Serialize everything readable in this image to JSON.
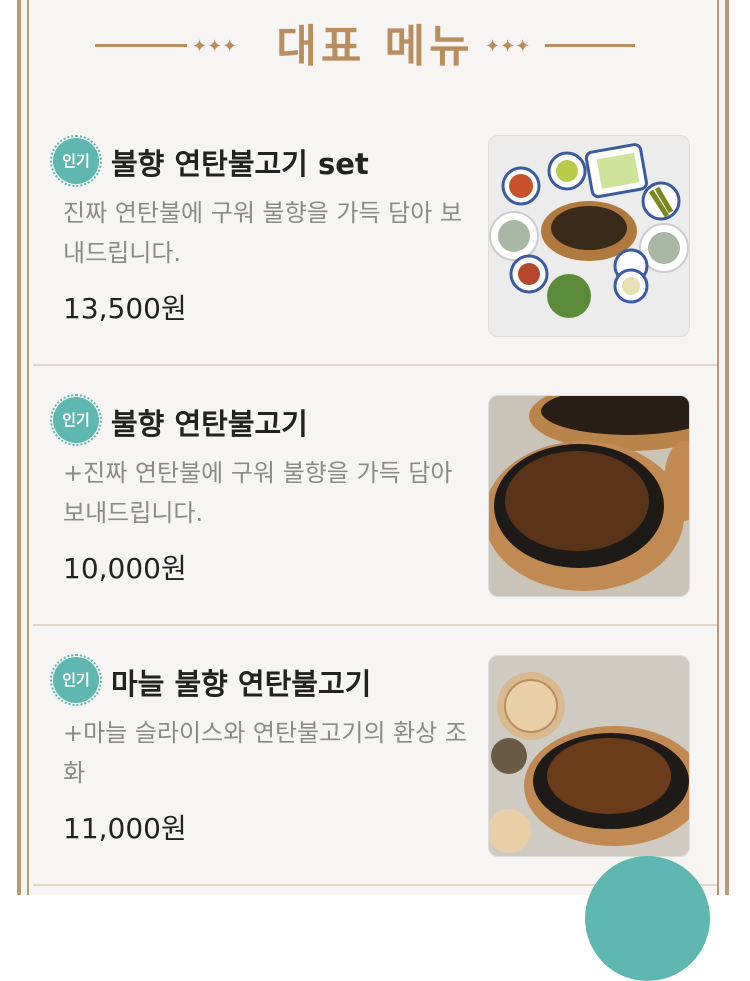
{
  "header": {
    "title": "대표 메뉴"
  },
  "menu": [
    {
      "badge": "인기",
      "name": "불향 연탄불고기 set",
      "description": "진짜 연탄불에 구워 불향을 가득 담아 보내드립니다.",
      "price": "13,500원"
    },
    {
      "badge": "인기",
      "name": "불향 연탄불고기",
      "description": "+진짜 연탄불에 구워 불향을 가득 담아 보내드립니다.",
      "price": "10,000원"
    },
    {
      "badge": "인기",
      "name": "마늘 불향 연탄불고기",
      "description": "+마늘 슬라이스와 연탄불고기의 환상 조화",
      "price": "11,000원"
    }
  ],
  "colors": {
    "accent": "#b98e5f",
    "badge": "#5fb7b2",
    "frame": "#b89a73"
  }
}
